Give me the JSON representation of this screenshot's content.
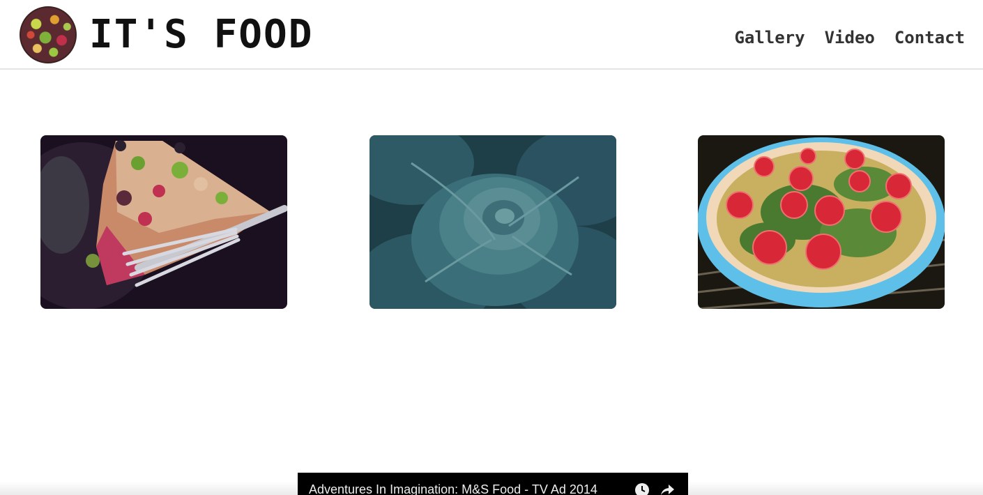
{
  "header": {
    "brand": "IT'S FOOD",
    "logo_icon": "food-collage-logo",
    "nav": [
      {
        "label": "Gallery"
      },
      {
        "label": "Video"
      },
      {
        "label": "Contact"
      }
    ]
  },
  "gallery": {
    "images": [
      {
        "subject": "cake-slice-with-fork"
      },
      {
        "subject": "cabbage"
      },
      {
        "subject": "tomato-quiche"
      }
    ]
  },
  "video": {
    "title": "Adventures In Imagination: M&S Food - TV Ad 2014",
    "icons": [
      "clock-icon",
      "share-icon"
    ]
  },
  "colors": {
    "text": "#111111",
    "nav_text": "#333333",
    "header_border": "#e4e4e4",
    "video_bar": "#000000"
  }
}
